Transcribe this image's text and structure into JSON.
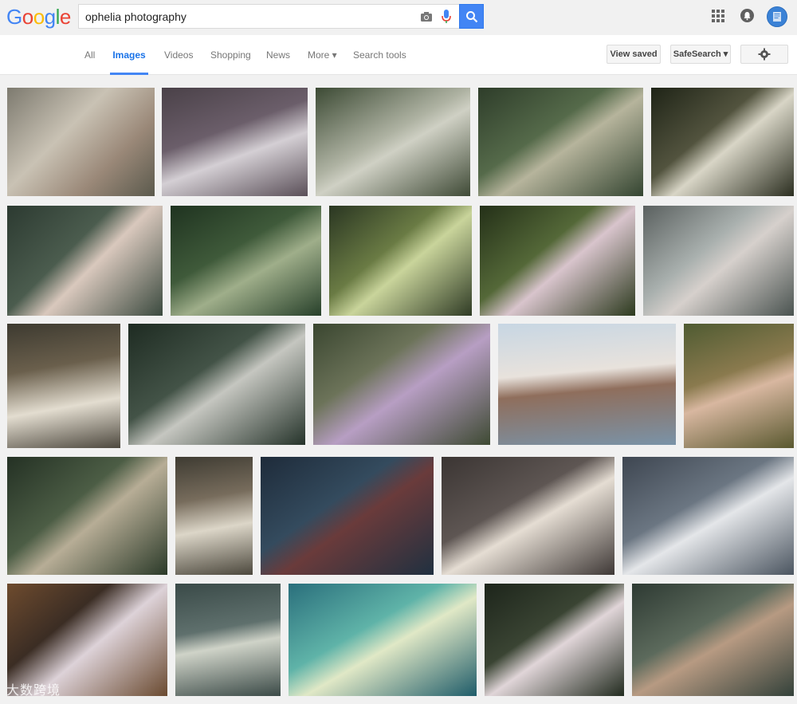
{
  "header": {
    "logo": [
      "G",
      "o",
      "o",
      "g",
      "l",
      "e"
    ],
    "logo_colors": [
      "#4285f4",
      "#ea4335",
      "#fbbc05",
      "#4285f4",
      "#34a853",
      "#ea4335"
    ],
    "search_value": "ophelia photography",
    "search_icon": "search-icon",
    "camera_icon": "camera-icon",
    "mic_icon": "mic-icon",
    "apps_icon": "apps-grid-icon",
    "bell_icon": "notifications-icon",
    "avatar_icon": "account-avatar"
  },
  "nav": {
    "tabs": [
      "All",
      "Images",
      "Videos",
      "Shopping",
      "News",
      "More ▾",
      "Search tools"
    ],
    "active": "Images",
    "view_saved": "View saved",
    "safesearch": "SafeSearch ▾",
    "settings_icon": "gear-icon"
  },
  "watermark": "大数跨境",
  "colors": {
    "accent": "#4285f4",
    "nav_active": "#1a73e8"
  },
  "images": [
    {
      "alt": "ophelia image 1"
    },
    {
      "alt": "ophelia image 2"
    },
    {
      "alt": "ophelia image 3"
    },
    {
      "alt": "ophelia image 4"
    },
    {
      "alt": "ophelia image 5"
    },
    {
      "alt": "ophelia image 6"
    },
    {
      "alt": "ophelia image 7"
    },
    {
      "alt": "ophelia image 8"
    },
    {
      "alt": "ophelia image 9"
    },
    {
      "alt": "ophelia image 10"
    },
    {
      "alt": "ophelia image 11"
    },
    {
      "alt": "ophelia image 12"
    },
    {
      "alt": "ophelia image 13"
    },
    {
      "alt": "ophelia image 14"
    },
    {
      "alt": "ophelia image 15"
    },
    {
      "alt": "ophelia image 16"
    },
    {
      "alt": "ophelia image 17"
    },
    {
      "alt": "ophelia image 18"
    },
    {
      "alt": "ophelia image 19"
    },
    {
      "alt": "ophelia image 20"
    },
    {
      "alt": "ophelia image 21"
    },
    {
      "alt": "ophelia image 22"
    },
    {
      "alt": "ophelia image 23"
    },
    {
      "alt": "ophelia image 24"
    },
    {
      "alt": "ophelia image 25"
    }
  ]
}
